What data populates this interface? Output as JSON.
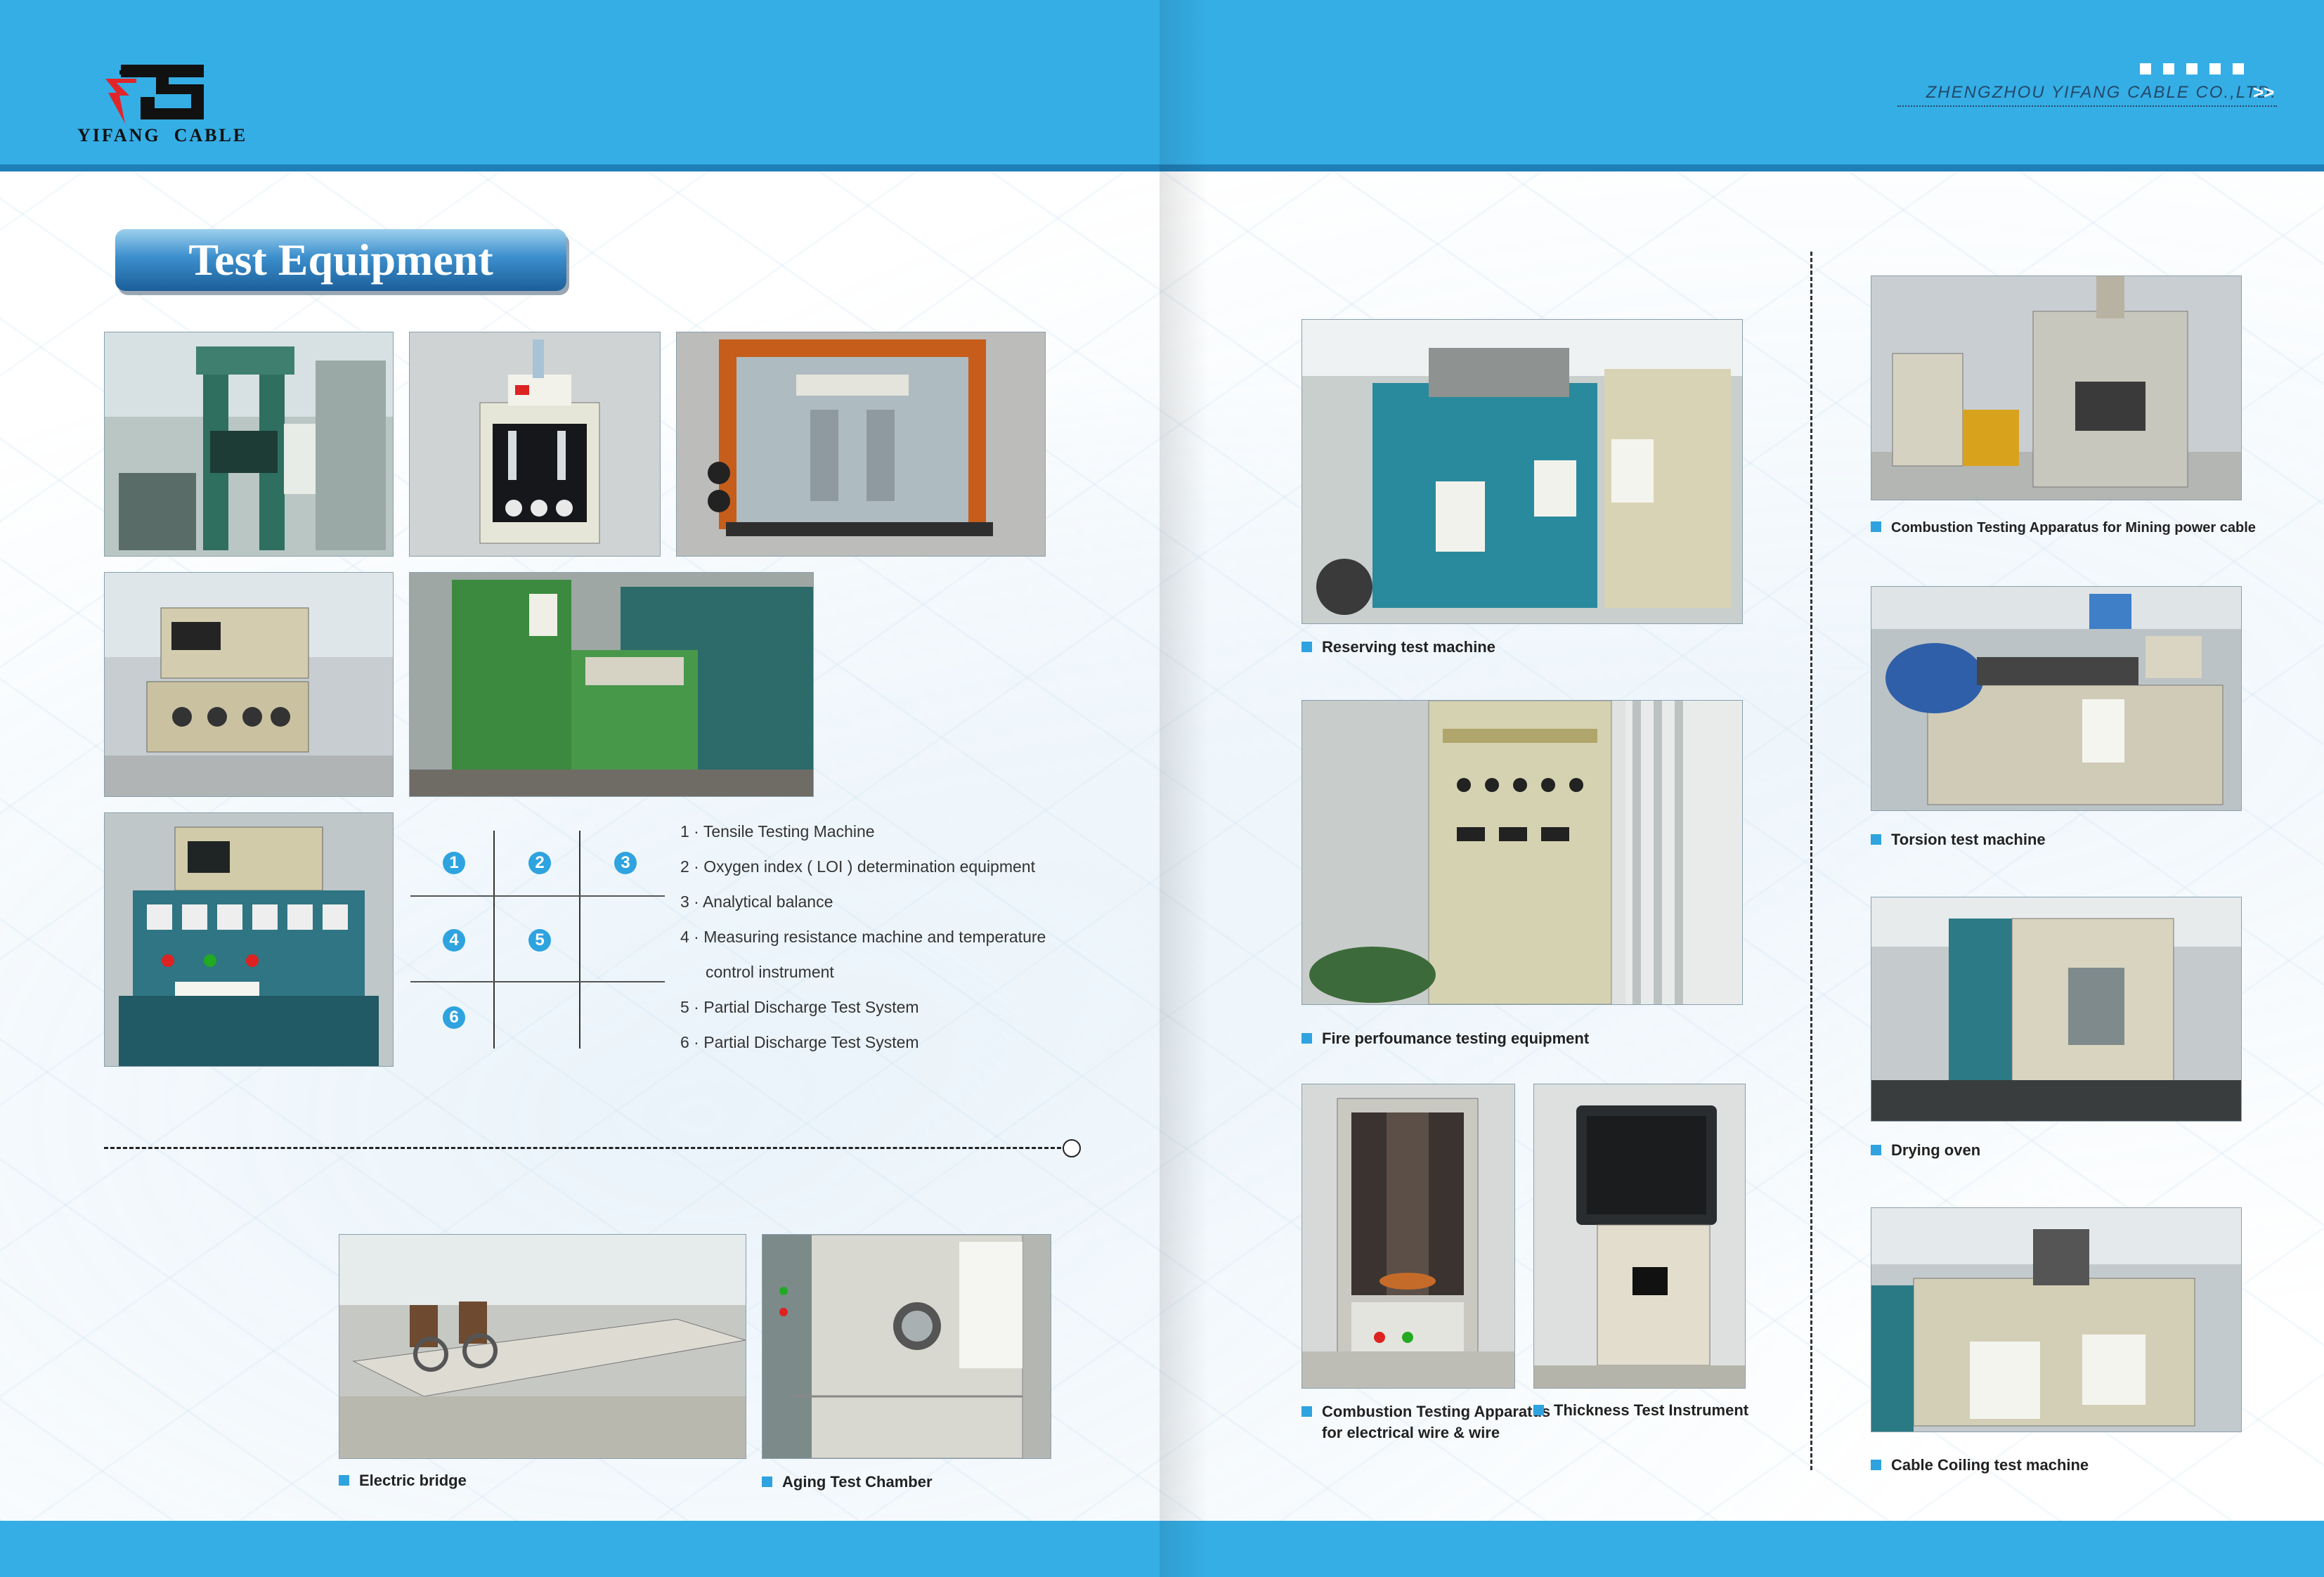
{
  "brand": {
    "logo_text": "YIFANG  CABLE",
    "company_name": "ZHENGZHOU YIFANG CABLE CO.,LTD.",
    "arrows": ">>"
  },
  "page_title": "Test Equipment",
  "colors": {
    "header_blue": "#35aee5",
    "header_rule": "#1f7fb8",
    "bullet_blue": "#2ea3df",
    "logo_red": "#e0262a"
  },
  "grid_numbers": [
    "1",
    "2",
    "3",
    "4",
    "5",
    "6"
  ],
  "equipment_list": [
    "1 · Tensile Testing Machine",
    "2 · Oxygen index ( LOI ) determination equipment",
    "3 · Analytical balance",
    "4 · Measuring resistance machine and temperature",
    "control instrument",
    "5 · Partial Discharge Test System",
    "6 · Partial Discharge Test System"
  ],
  "captions": {
    "electric_bridge": "Electric bridge",
    "aging_chamber": "Aging Test Chamber",
    "reserving": "Reserving test machine",
    "fire": "Fire perfoumance testing equipment",
    "combustion_wire_1": "Combustion Testing Apparatus",
    "combustion_wire_2": "for electrical wire & wire",
    "thickness": "Thickness Test Instrument",
    "combustion_mining": "Combustion Testing Apparatus for Mining power cable",
    "torsion": "Torsion test machine",
    "drying": "Drying oven",
    "coiling": "Cable Coiling test machine"
  },
  "photos": [
    {
      "id": "tensile",
      "subject": "tensile-testing-machine",
      "tone": "#5f7f78"
    },
    {
      "id": "oxygen",
      "subject": "oxygen-index-equipment",
      "tone": "#b9c2c6"
    },
    {
      "id": "balance",
      "subject": "analytical-balance",
      "tone": "#c36d2c"
    },
    {
      "id": "resistance",
      "subject": "resistance-measuring-machine",
      "tone": "#c8c4a6"
    },
    {
      "id": "pd1",
      "subject": "partial-discharge-system",
      "tone": "#3d8f4d"
    },
    {
      "id": "pd2",
      "subject": "partial-discharge-console",
      "tone": "#2f6a7e"
    },
    {
      "id": "bridge",
      "subject": "electric-bridge",
      "tone": "#b7b2a4"
    },
    {
      "id": "aging",
      "subject": "aging-test-chamber",
      "tone": "#cfcfc7"
    },
    {
      "id": "reserving",
      "subject": "reserving-test-machine",
      "tone": "#2d8fa3"
    },
    {
      "id": "fire",
      "subject": "fire-performance-equipment",
      "tone": "#c9c9ab"
    },
    {
      "id": "combwire",
      "subject": "combustion-apparatus-wire",
      "tone": "#8f8878"
    },
    {
      "id": "thickness",
      "subject": "thickness-test-instrument",
      "tone": "#d8d3c3"
    },
    {
      "id": "combmine",
      "subject": "combustion-apparatus-mining",
      "tone": "#b8b7ae"
    },
    {
      "id": "torsion",
      "subject": "torsion-test-machine",
      "tone": "#2f5fa8"
    },
    {
      "id": "drying",
      "subject": "drying-oven",
      "tone": "#d6d1b9"
    },
    {
      "id": "coiling",
      "subject": "cable-coiling-machine",
      "tone": "#bdc3b6"
    }
  ]
}
